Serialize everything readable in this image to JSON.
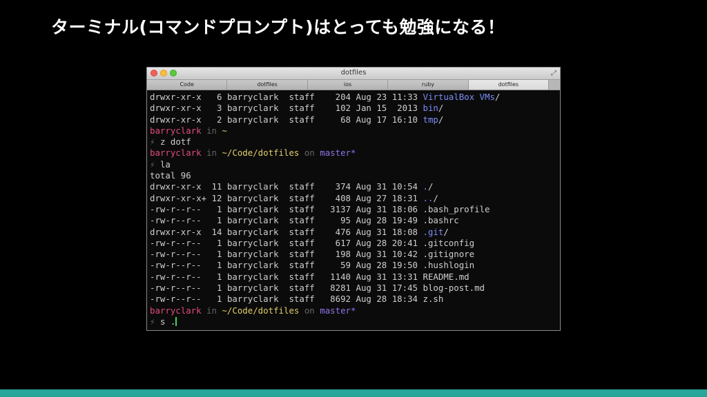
{
  "slide": {
    "title": "ターミナル(コマンドプロンプト)はとっても勉強になる！"
  },
  "window": {
    "title": "dotfiles",
    "tabs": [
      "Code",
      "dotfiles",
      "ios",
      "ruby",
      "dotfiles"
    ],
    "active_tab": 4
  },
  "terminal": {
    "lines": [
      {
        "type": "entry",
        "perms": "drwxr-xr-x",
        "links": "6",
        "owner": "barryclark",
        "group": "staff",
        "size": "204",
        "date": "Aug 23 11:33",
        "name": "VirtualBox VMs",
        "dir": true
      },
      {
        "type": "entry",
        "perms": "drwxr-xr-x",
        "links": "3",
        "owner": "barryclark",
        "group": "staff",
        "size": "102",
        "date": "Jan 15  2013",
        "name": "bin",
        "dir": true
      },
      {
        "type": "entry",
        "perms": "drwxr-xr-x",
        "links": "2",
        "owner": "barryclark",
        "group": "staff",
        "size": "68",
        "date": "Aug 17 16:10",
        "name": "tmp",
        "dir": true
      },
      {
        "type": "prompt",
        "user": "barryclark",
        "in": "in",
        "path": "~"
      },
      {
        "type": "cmd",
        "sym": "⚡",
        "text": "z dotf"
      },
      {
        "type": "prompt",
        "user": "barryclark",
        "in": "in",
        "path": "~/Code/dotfiles",
        "on": "on",
        "branch": "master*"
      },
      {
        "type": "cmd",
        "sym": "⚡",
        "text": "la"
      },
      {
        "type": "text",
        "text": "total 96"
      },
      {
        "type": "entry",
        "perms": "drwxr-xr-x",
        "links": "11",
        "owner": "barryclark",
        "group": "staff",
        "size": "374",
        "date": "Aug 31 10:54",
        "name": ".",
        "dir": true
      },
      {
        "type": "entry",
        "perms": "drwxr-xr-x+",
        "links": "12",
        "owner": "barryclark",
        "group": "staff",
        "size": "408",
        "date": "Aug 27 18:31",
        "name": "..",
        "dir": true
      },
      {
        "type": "entry",
        "perms": "-rw-r--r--",
        "links": "1",
        "owner": "barryclark",
        "group": "staff",
        "size": "3137",
        "date": "Aug 31 18:06",
        "name": ".bash_profile",
        "dir": false
      },
      {
        "type": "entry",
        "perms": "-rw-r--r--",
        "links": "1",
        "owner": "barryclark",
        "group": "staff",
        "size": "95",
        "date": "Aug 28 19:49",
        "name": ".bashrc",
        "dir": false
      },
      {
        "type": "entry",
        "perms": "drwxr-xr-x",
        "links": "14",
        "owner": "barryclark",
        "group": "staff",
        "size": "476",
        "date": "Aug 31 18:08",
        "name": ".git",
        "dir": true
      },
      {
        "type": "entry",
        "perms": "-rw-r--r--",
        "links": "1",
        "owner": "barryclark",
        "group": "staff",
        "size": "617",
        "date": "Aug 28 20:41",
        "name": ".gitconfig",
        "dir": false
      },
      {
        "type": "entry",
        "perms": "-rw-r--r--",
        "links": "1",
        "owner": "barryclark",
        "group": "staff",
        "size": "198",
        "date": "Aug 31 10:42",
        "name": ".gitignore",
        "dir": false
      },
      {
        "type": "entry",
        "perms": "-rw-r--r--",
        "links": "1",
        "owner": "barryclark",
        "group": "staff",
        "size": "59",
        "date": "Aug 28 19:50",
        "name": ".hushlogin",
        "dir": false
      },
      {
        "type": "entry",
        "perms": "-rw-r--r--",
        "links": "1",
        "owner": "barryclark",
        "group": "staff",
        "size": "1140",
        "date": "Aug 31 13:31",
        "name": "README.md",
        "dir": false
      },
      {
        "type": "entry",
        "perms": "-rw-r--r--",
        "links": "1",
        "owner": "barryclark",
        "group": "staff",
        "size": "8281",
        "date": "Aug 31 17:45",
        "name": "blog-post.md",
        "dir": false
      },
      {
        "type": "entry",
        "perms": "-rw-r--r--",
        "links": "1",
        "owner": "barryclark",
        "group": "staff",
        "size": "8692",
        "date": "Aug 28 18:34",
        "name": "z.sh",
        "dir": false
      },
      {
        "type": "prompt",
        "user": "barryclark",
        "in": "in",
        "path": "~/Code/dotfiles",
        "on": "on",
        "branch": "master*"
      },
      {
        "type": "cmd",
        "sym": "⚡",
        "text": "s .",
        "cursor": true
      }
    ]
  },
  "colors": {
    "background": "#000000",
    "accent_bar": "#2aa59a",
    "directory": "#7b8cf6",
    "user": "#e04d7a",
    "path": "#e2cf6a",
    "branch": "#8f74e8",
    "cursor": "#3ddc5c"
  },
  "icons": [
    "close-light-icon",
    "minimize-light-icon",
    "zoom-light-icon",
    "fullscreen-icon",
    "lightning-prompt-icon"
  ]
}
